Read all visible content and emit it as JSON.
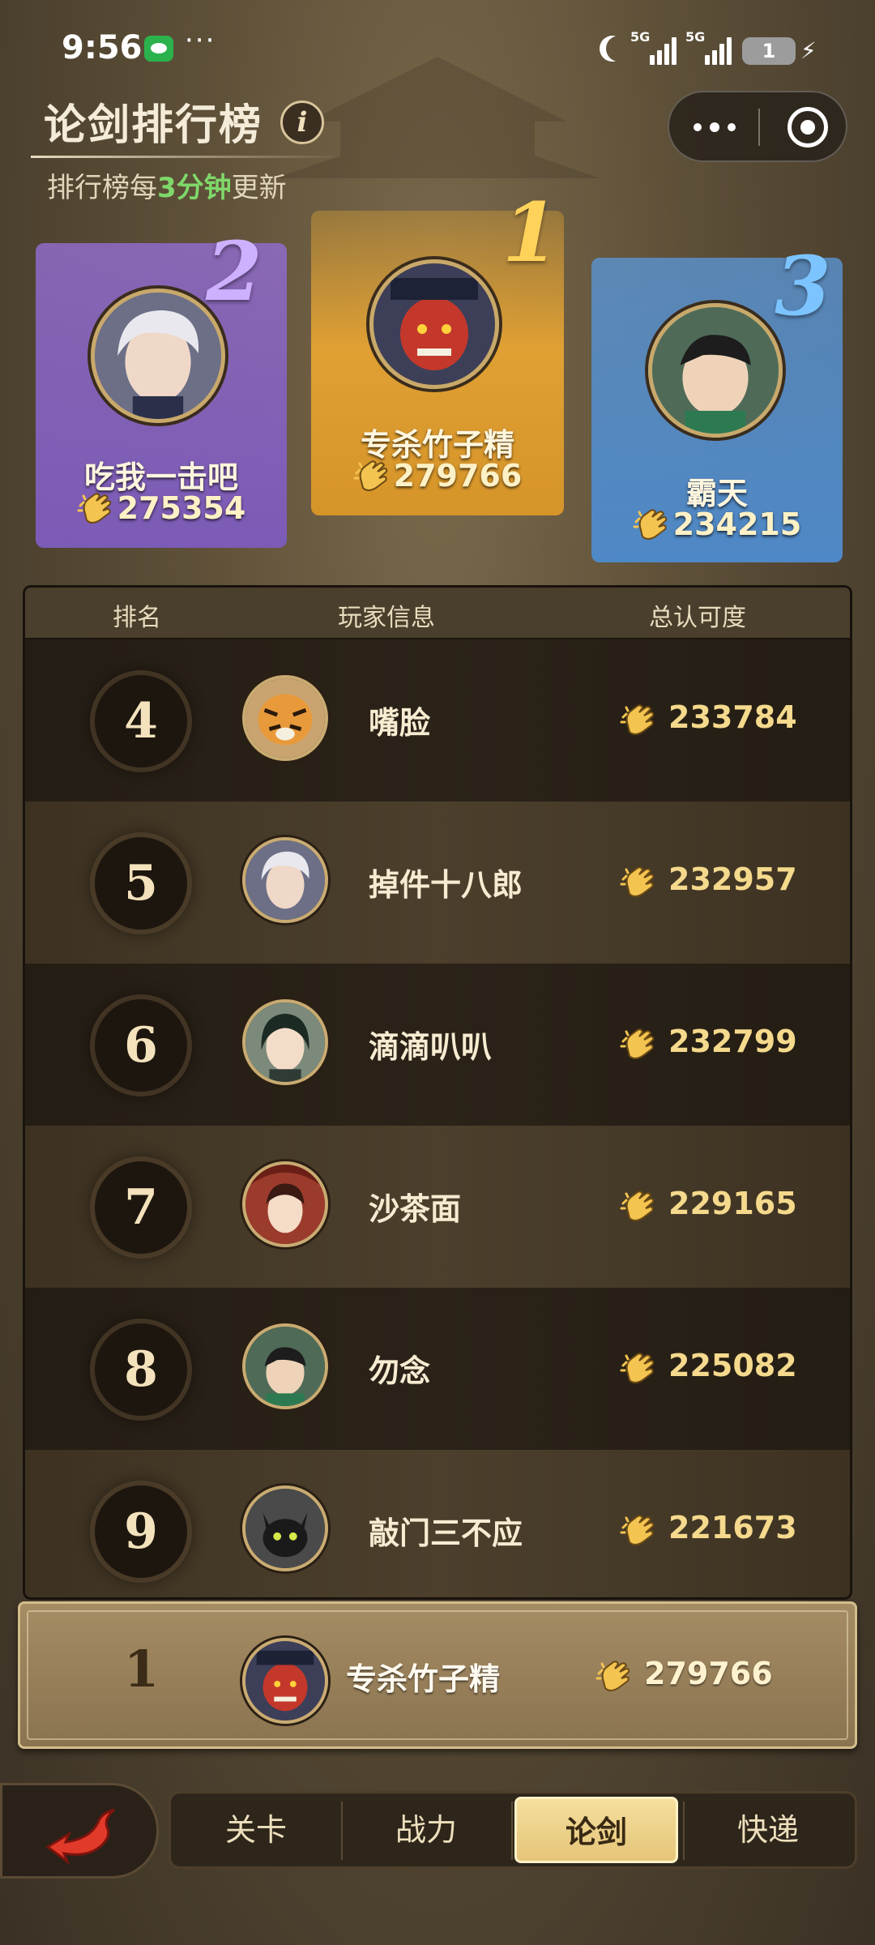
{
  "status_bar": {
    "time": "9:56",
    "extra": "···",
    "sim1_label": "5G",
    "sim2_label": "5G",
    "battery": "1"
  },
  "header": {
    "title": "论剑排行榜",
    "info_label": "i",
    "subtitle_prefix": "排行榜每",
    "subtitle_highlight": "3分钟",
    "subtitle_suffix": "更新"
  },
  "podium": [
    {
      "rank": "1",
      "name": "专杀竹子精",
      "score": "279766",
      "color": "#e8a935"
    },
    {
      "rank": "2",
      "name": "吃我一击吧",
      "score": "275354",
      "color": "#8f6bc9"
    },
    {
      "rank": "3",
      "name": "霸天",
      "score": "234215",
      "color": "#5a94d2"
    }
  ],
  "table": {
    "headers": {
      "rank": "排名",
      "player": "玩家信息",
      "score": "总认可度"
    },
    "rows": [
      {
        "rank": "4",
        "name": "嘴脸",
        "score": "233784",
        "avatar": "tiger"
      },
      {
        "rank": "5",
        "name": "掉件十八郎",
        "score": "232957",
        "avatar": "white-hair"
      },
      {
        "rank": "6",
        "name": "滴滴叭叭",
        "score": "232799",
        "avatar": "green-hair"
      },
      {
        "rank": "7",
        "name": "沙茶面",
        "score": "229165",
        "avatar": "umbrella-girl"
      },
      {
        "rank": "8",
        "name": "勿念",
        "score": "225082",
        "avatar": "bowl-head"
      },
      {
        "rank": "9",
        "name": "敲门三不应",
        "score": "221673",
        "avatar": "black-cat"
      }
    ]
  },
  "my_rank": {
    "rank": "1",
    "name": "专杀竹子精",
    "score": "279766"
  },
  "tabs": [
    "关卡",
    "战力",
    "论剑",
    "快递"
  ],
  "active_tab": "论剑",
  "colors": {
    "highlight_green": "#7fd86a",
    "score_gold": "#f5d98c",
    "frame": "#c9ab72"
  }
}
